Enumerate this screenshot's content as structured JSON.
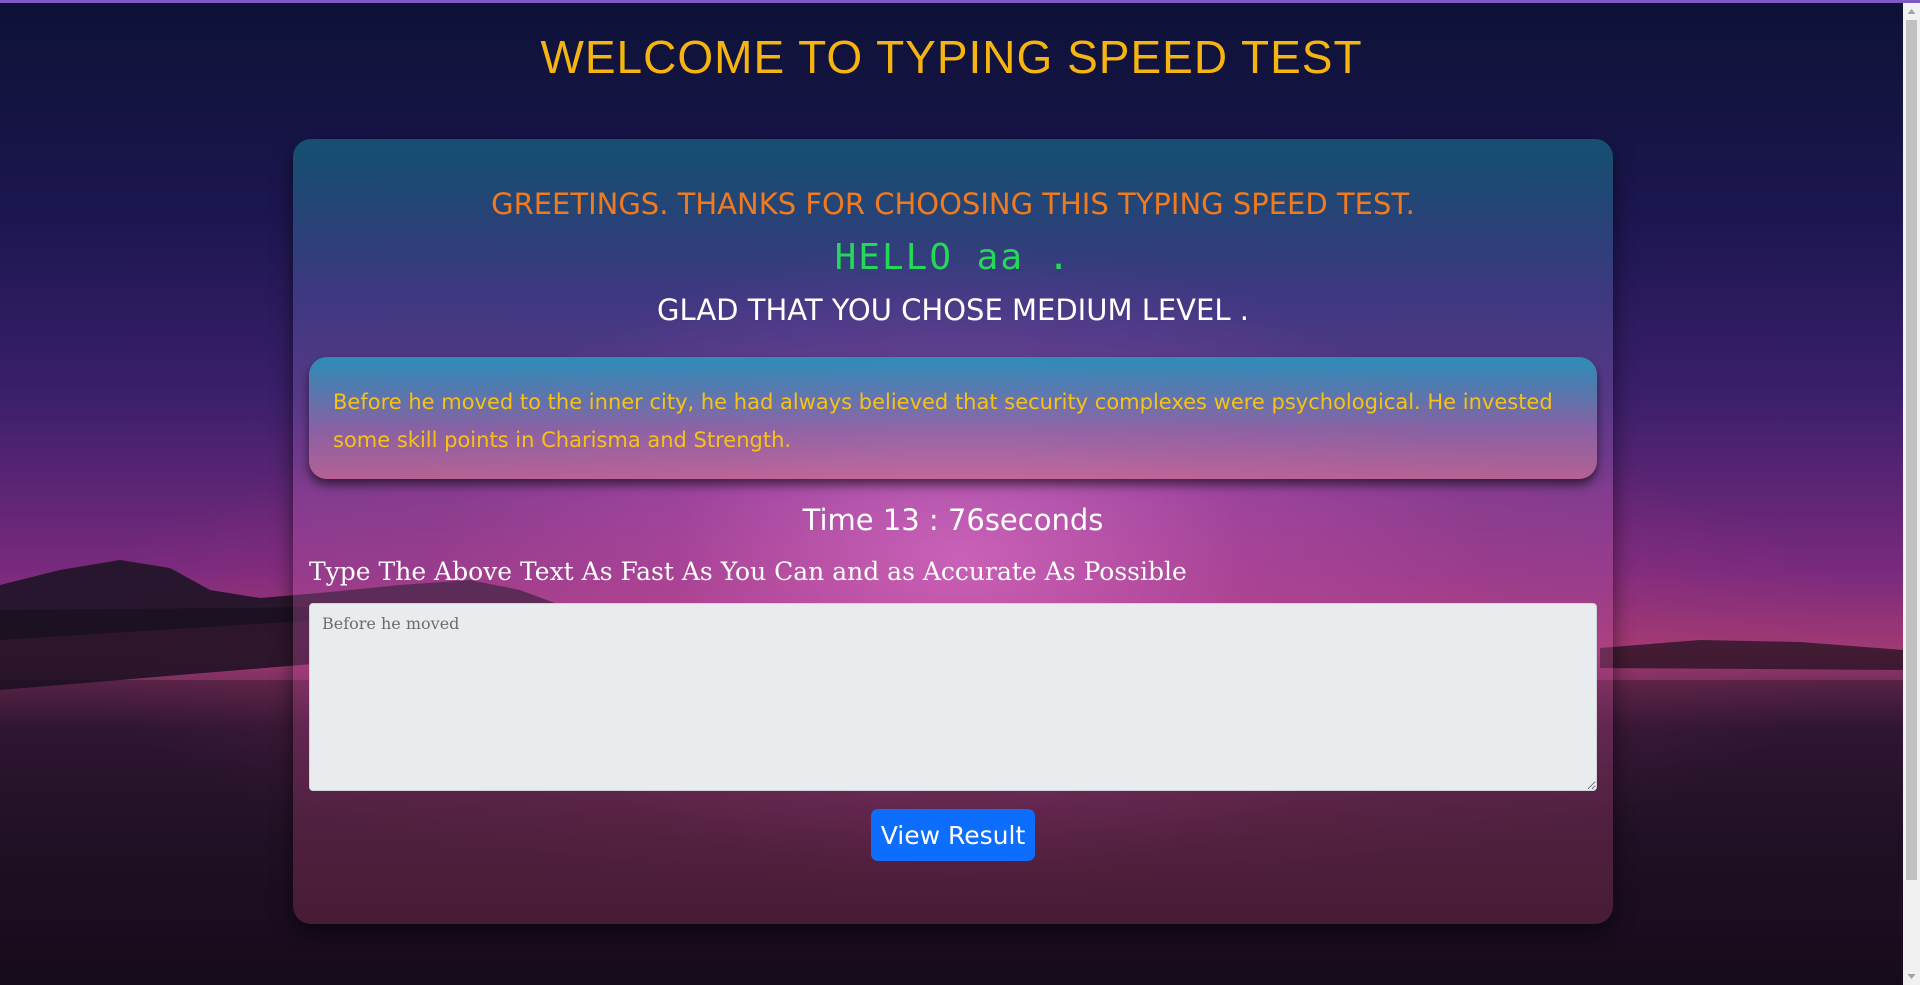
{
  "page": {
    "title": "WELCOME TO TYPING SPEED TEST"
  },
  "card": {
    "greeting": "GREETINGS. THANKS FOR CHOOSING THIS TYPING SPEED TEST.",
    "hello": "HELLO aa .",
    "level": "GLAD THAT YOU CHOSE MEDIUM LEVEL .",
    "passage": "Before he moved to the inner city, he had always believed that security complexes were psychological. He invested some skill points in Charisma and Strength.",
    "timer": "Time 13 : 76seconds",
    "instruction": "Type The Above Text As Fast As You Can and as Accurate As Possible",
    "input": {
      "value": "",
      "placeholder": "Before he moved"
    },
    "result_button": "View Result"
  },
  "colors": {
    "title": "#f5b40f",
    "greeting": "#f07a1e",
    "hello": "#24d858",
    "passage_text": "#f5c21a",
    "button": "#0d6efd"
  }
}
